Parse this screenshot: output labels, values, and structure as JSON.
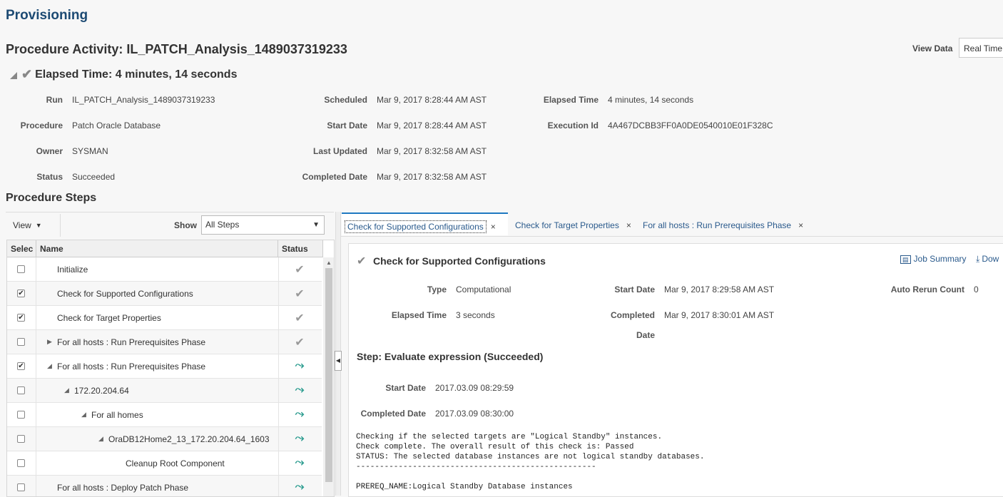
{
  "app_title": "Provisioning",
  "page_title": "Procedure Activity: IL_PATCH_Analysis_1489037319233",
  "view_data": {
    "label": "View Data",
    "value": "Real Time"
  },
  "elapsed_header": "Elapsed Time: 4 minutes, 14 seconds",
  "summary": {
    "run_label": "Run",
    "run": "IL_PATCH_Analysis_1489037319233",
    "procedure_label": "Procedure",
    "procedure": "Patch Oracle Database",
    "owner_label": "Owner",
    "owner": "SYSMAN",
    "status_label": "Status",
    "status": "Succeeded",
    "scheduled_label": "Scheduled",
    "scheduled": "Mar 9, 2017 8:28:44 AM AST",
    "start_date_label": "Start Date",
    "start_date": "Mar 9, 2017 8:28:44 AM AST",
    "last_updated_label": "Last Updated",
    "last_updated": "Mar 9, 2017 8:32:58 AM AST",
    "completed_date_label": "Completed Date",
    "completed_date": "Mar 9, 2017 8:32:58 AM AST",
    "elapsed_time_label": "Elapsed Time",
    "elapsed_time": "4 minutes, 14 seconds",
    "execution_id_label": "Execution Id",
    "execution_id": "4A467DCBB3FF0A0DE0540010E01F328C"
  },
  "steps_title": "Procedure Steps",
  "toolbar": {
    "view": "View",
    "show_label": "Show",
    "show_value": "All Steps"
  },
  "table": {
    "headers": {
      "select": "Selec",
      "name": "Name",
      "status": "Status"
    },
    "rows": [
      {
        "name": "Initialize",
        "checked": false,
        "status": "done"
      },
      {
        "name": "Check for Supported Configurations",
        "checked": true,
        "status": "done"
      },
      {
        "name": "Check for Target Properties",
        "checked": true,
        "status": "done"
      },
      {
        "name": "For all hosts : Run Prerequisites Phase",
        "checked": false,
        "status": "done"
      },
      {
        "name": "For all hosts : Run Prerequisites Phase",
        "checked": true,
        "status": "branch"
      },
      {
        "name": "172.20.204.64",
        "checked": false,
        "status": "branch"
      },
      {
        "name": "For all homes",
        "checked": false,
        "status": "branch"
      },
      {
        "name": "OraDB12Home2_13_172.20.204.64_1603",
        "checked": false,
        "status": "branch"
      },
      {
        "name": "Cleanup Root Component",
        "checked": false,
        "status": "branch"
      },
      {
        "name": "For all hosts : Deploy Patch Phase",
        "checked": false,
        "status": "branch"
      }
    ]
  },
  "tabs": [
    {
      "label": "Check for Supported Configurations"
    },
    {
      "label": "Check for Target Properties"
    },
    {
      "label": "For all hosts : Run Prerequisites Phase"
    }
  ],
  "detail": {
    "title": "Check for Supported Configurations",
    "job_summary": "Job Summary",
    "download": "Dow",
    "type_label": "Type",
    "type": "Computational",
    "elapsed_label": "Elapsed Time",
    "elapsed": "3 seconds",
    "start_label": "Start Date",
    "start": "Mar 9, 2017 8:29:58 AM AST",
    "completed_label_1": "Completed",
    "completed_label_2": "Date",
    "completed": "Mar 9, 2017 8:30:01 AM AST",
    "auto_rerun_label": "Auto Rerun Count",
    "auto_rerun": "0",
    "step_title": "Step: Evaluate expression (Succeeded)",
    "step_start_label": "Start Date",
    "step_start": "2017.03.09 08:29:59",
    "step_completed_label": "Completed Date",
    "step_completed": "2017.03.09 08:30:00",
    "log": "Checking if the selected targets are \"Logical Standby\" instances.\nCheck complete. The overall result of this check is: Passed\nSTATUS: The selected database instances are not logical standby databases.\n---------------------------------------------------\n\nPREREQ_NAME:Logical Standby Database instances"
  }
}
